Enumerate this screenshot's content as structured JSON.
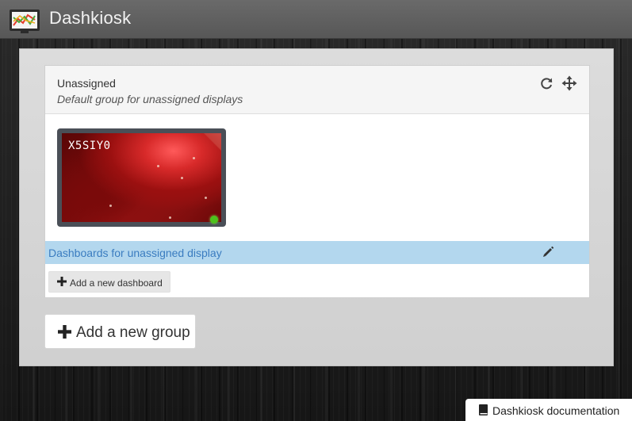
{
  "app": {
    "title": "Dashkiosk",
    "logo_icon": "monitor-chart-icon"
  },
  "group": {
    "name": "Unassigned",
    "description": "Default group for unassigned displays",
    "actions": [
      {
        "icon": "refresh-icon",
        "label": "Refresh"
      },
      {
        "icon": "move-icon",
        "label": "Move"
      }
    ]
  },
  "display": {
    "name": "X5SIY0",
    "status": "online",
    "status_color": "#4cc21c"
  },
  "dashboards": {
    "header_label": "Dashboards for unassigned display",
    "edit_icon": "pencil-icon",
    "add_label": "Add a new dashboard"
  },
  "add_group_label": "Add a new group",
  "docs_link": {
    "icon": "book-icon",
    "label": "Dashkiosk documentation"
  },
  "colors": {
    "topbar": "#5f5f5f",
    "panel": "#d6d6d6",
    "dashboard_bar": "#b3d7ee",
    "dashboard_bar_text": "#3a7cc0"
  }
}
